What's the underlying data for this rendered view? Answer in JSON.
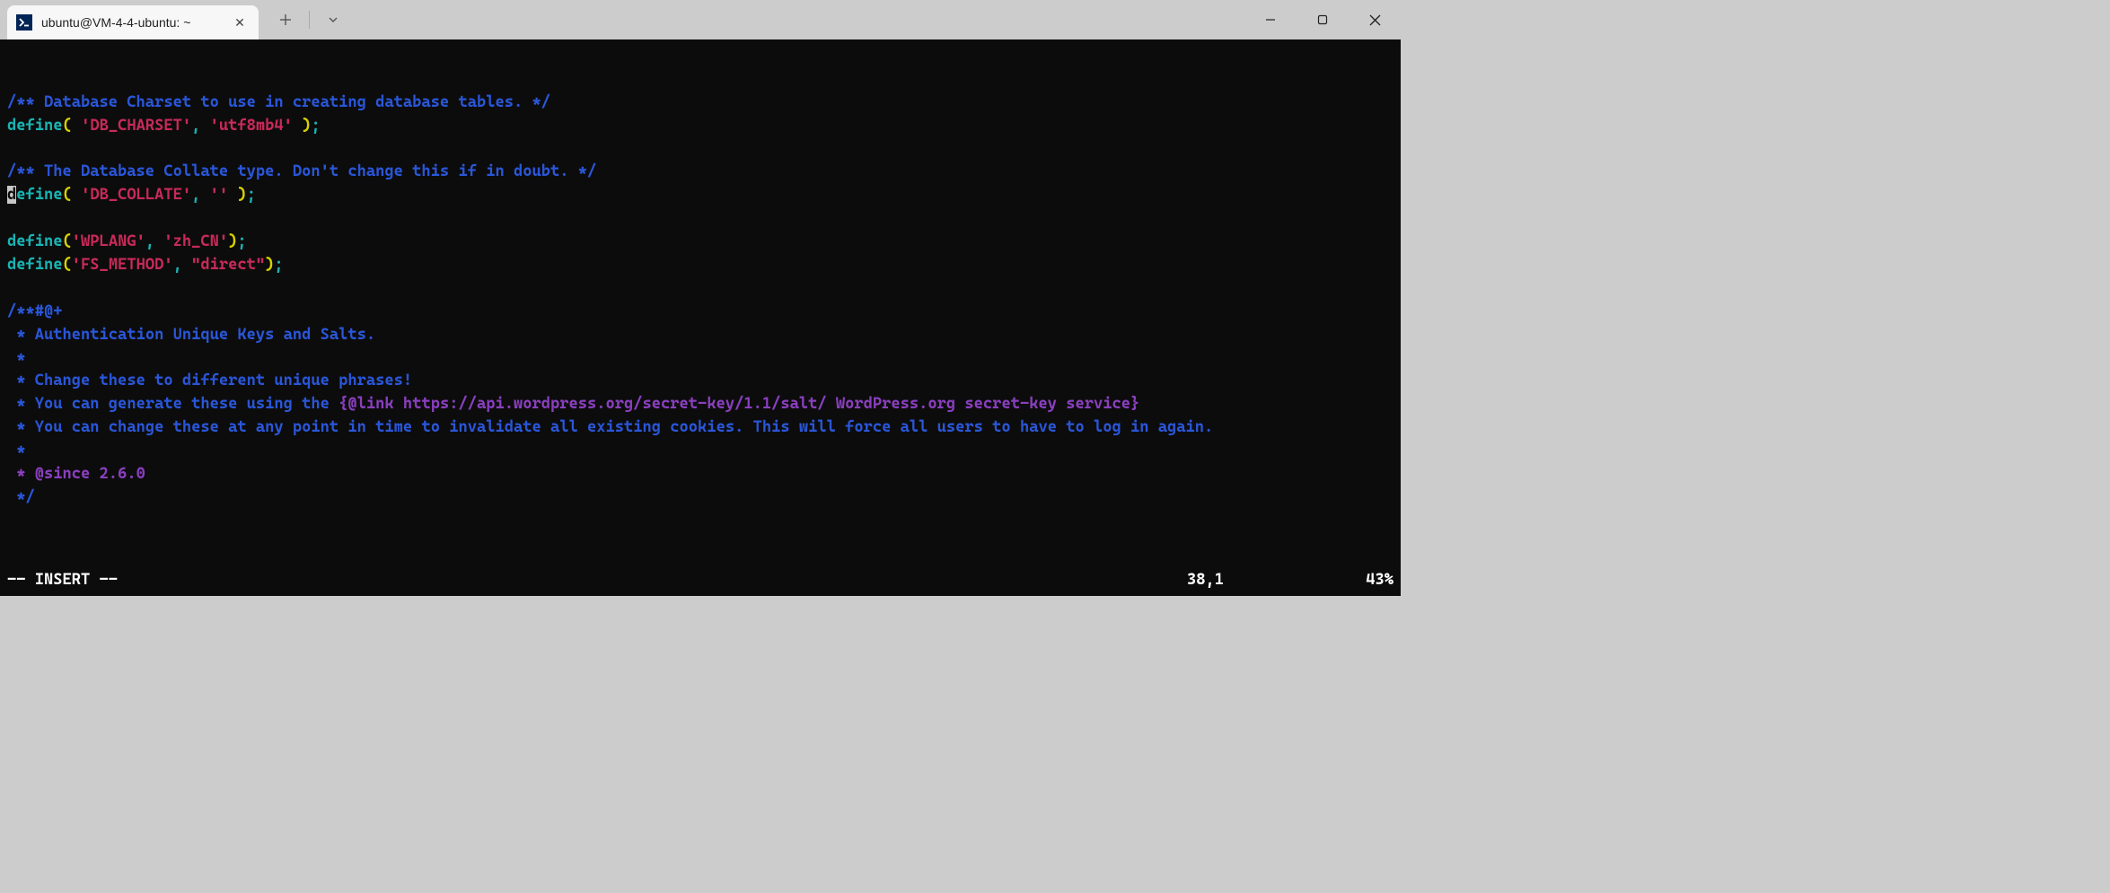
{
  "tab": {
    "title": "ubuntu@VM-4-4-ubuntu: ~",
    "icon_glyph": ">_"
  },
  "code": {
    "line1_comment": "/** Database Charset to use in creating database tables. */",
    "line2_define": "define",
    "line2_key": "'DB_CHARSET'",
    "line2_val": "'utf8mb4'",
    "line4_comment": "/** The Database Collate type. Don't change this if in doubt. */",
    "line5_define": "define",
    "line5_key": "'DB_COLLATE'",
    "line5_val": "''",
    "line7_define": "define",
    "line7_key": "'WPLANG'",
    "line7_val": "'zh_CN'",
    "line8_define": "define",
    "line8_key": "'FS_METHOD'",
    "line8_val": "\"direct\"",
    "block_open": "/**#@+",
    "block_l1": " * Authentication Unique Keys and Salts.",
    "block_l2": " *",
    "block_l3": " * Change these to different unique phrases!",
    "block_l4a": " * You can generate these using the ",
    "block_l4_link": "{@link https://api.wordpress.org/secret-key/1.1/salt/ WordPress.org secret-key service}",
    "block_l5": " * You can change these at any point in time to invalidate all existing cookies. This will force all users to have to log in again.",
    "block_l6": " *",
    "block_l7": " * @since 2.6.0",
    "block_close": " */"
  },
  "status": {
    "mode": "-- INSERT --",
    "position": "38,1",
    "percent": "43%"
  }
}
